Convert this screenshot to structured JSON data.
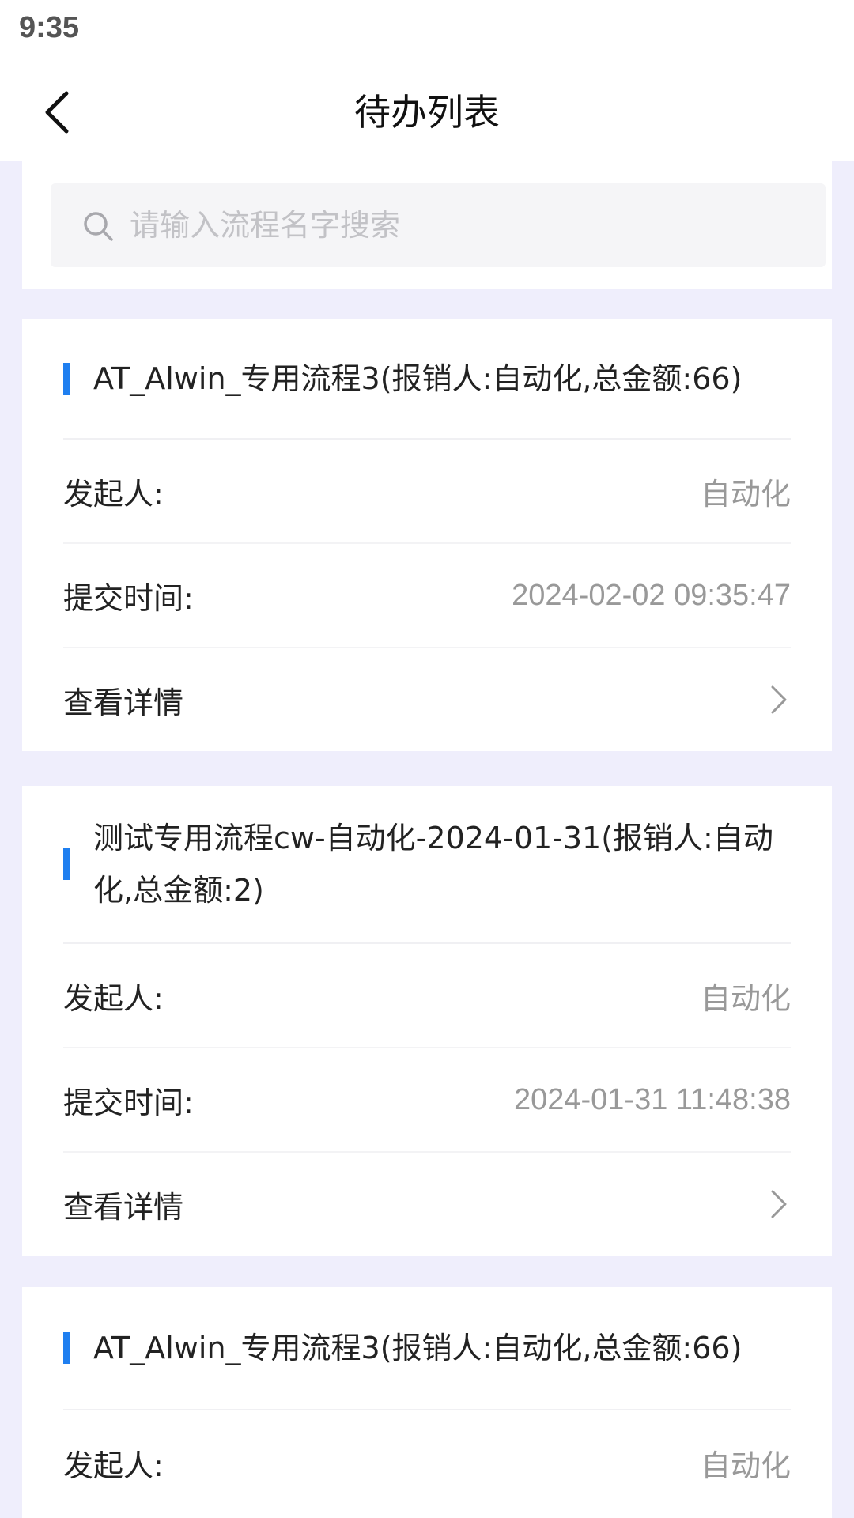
{
  "status_bar": {
    "time": "9:35"
  },
  "header": {
    "title": "待办列表"
  },
  "search": {
    "placeholder": "请输入流程名字搜索",
    "value": ""
  },
  "labels": {
    "initiator": "发起人:",
    "submit_time": "提交时间:",
    "view_details": "查看详情"
  },
  "items": [
    {
      "title": "AT_Alwin_专用流程3(报销人:自动化,总金额:66)",
      "initiator": "自动化",
      "submit_time": "2024-02-02 09:35:47"
    },
    {
      "title": "测试专用流程cw-自动化-2024-01-31(报销人:自动化,总金额:2)",
      "initiator": "自动化",
      "submit_time": "2024-01-31 11:48:38"
    },
    {
      "title": "AT_Alwin_专用流程3(报销人:自动化,总金额:66)",
      "initiator": "自动化"
    }
  ],
  "colors": {
    "accent": "#1f7ff0",
    "background": "#efeefc"
  },
  "icons": [
    "back-arrow-icon",
    "search-icon",
    "chevron-right-icon"
  ]
}
